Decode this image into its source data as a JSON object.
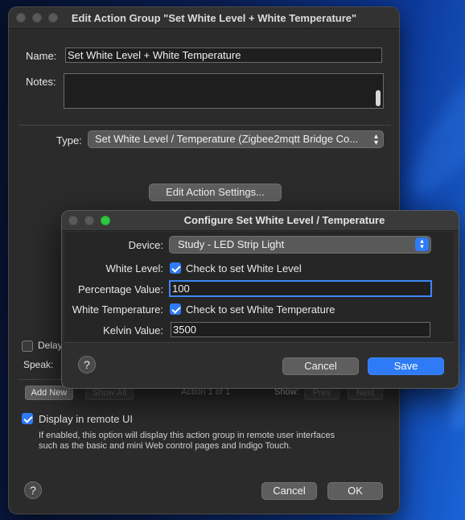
{
  "main_window": {
    "title": "Edit Action Group \"Set White Level + White Temperature\"",
    "name_label": "Name:",
    "name_value": "Set White Level + White Temperature",
    "notes_label": "Notes:",
    "type_label": "Type:",
    "type_value": "Set White Level / Temperature (Zigbee2mqtt Bridge Co...",
    "edit_settings_button": "Edit Action Settings...",
    "delay_label": "Delay",
    "speak_label": "Speak:",
    "add_new_button": "Add New",
    "show_all_button": "Show All",
    "action_counter": "Action 1 of 1",
    "show_label": "Show:",
    "prev_button": "Prev",
    "next_button": "Next",
    "remote_ui_label": "Display in remote UI",
    "remote_ui_checked": true,
    "remote_ui_note_line1": "If enabled, this option will display this action group in remote user interfaces",
    "remote_ui_note_line2": "such as the basic and mini Web control pages and Indigo Touch.",
    "help_icon": "?",
    "cancel_button": "Cancel",
    "ok_button": "OK"
  },
  "dialog": {
    "title": "Configure Set White Level / Temperature",
    "device_label": "Device:",
    "device_value": "Study - LED Strip Light",
    "white_level_label": "White Level:",
    "white_level_checkbox": "Check to set White Level",
    "white_level_checked": true,
    "percentage_label": "Percentage Value:",
    "percentage_value": "100",
    "white_temp_label": "White Temperature:",
    "white_temp_checkbox": "Check to set White Temperature",
    "white_temp_checked": true,
    "kelvin_label": "Kelvin Value:",
    "kelvin_value": "3500",
    "help_icon": "?",
    "cancel_button": "Cancel",
    "save_button": "Save"
  },
  "colors": {
    "accent": "#2f7bf5",
    "traffic_close": "#5a5a5a",
    "traffic_min": "#5a5a5a",
    "traffic_max_active": "#2dc840"
  }
}
